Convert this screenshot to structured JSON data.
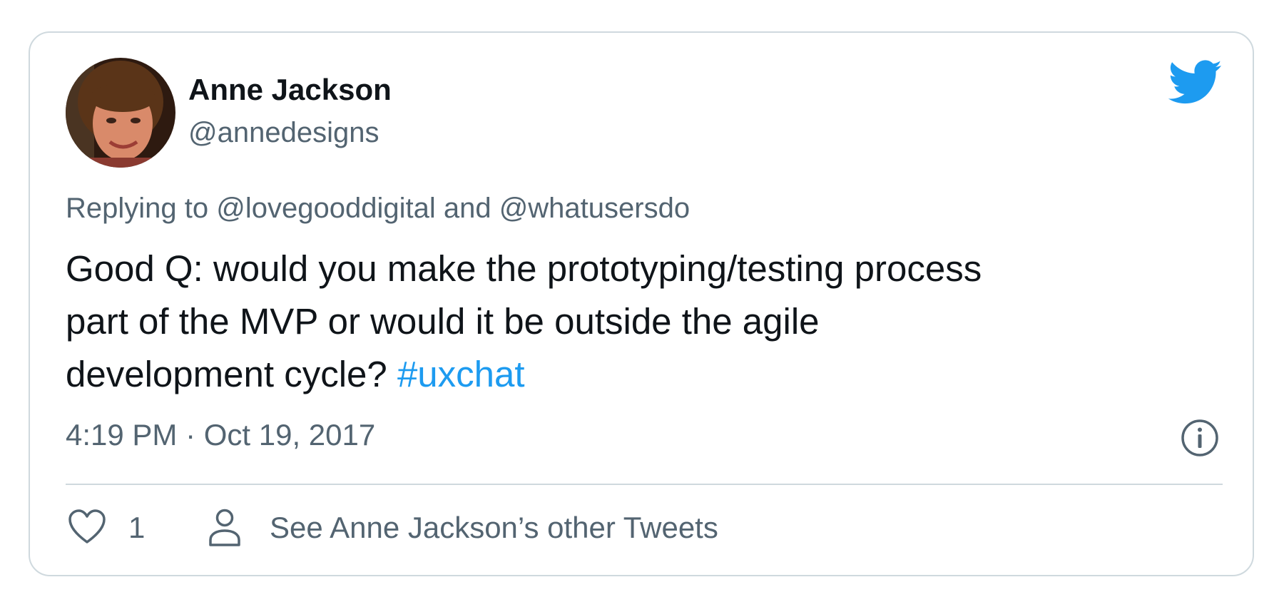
{
  "tweet": {
    "author": {
      "name": "Anne Jackson",
      "handle": "@annedesigns"
    },
    "reply": {
      "prefix": "Replying to ",
      "to1": "@lovegooddigital",
      "and": " and ",
      "to2": "@whatusersdo"
    },
    "text_line1": "Good Q: would you make the prototyping/testing process",
    "text_line2": "part of the MVP or would it be outside the agile",
    "text_line3": "development cycle? ",
    "hashtag": "#uxchat",
    "timestamp": "4:19 PM · Oct 19, 2017",
    "likes": "1",
    "see_other": "See Anne Jackson’s other Tweets"
  },
  "colors": {
    "accent": "#1d9bf0",
    "text": "#0f1419",
    "secondary": "#536471",
    "border": "#cfd9de"
  },
  "icons": {
    "brand": "twitter-bird-icon",
    "info": "info-icon",
    "like": "heart-icon",
    "profile": "person-icon"
  }
}
